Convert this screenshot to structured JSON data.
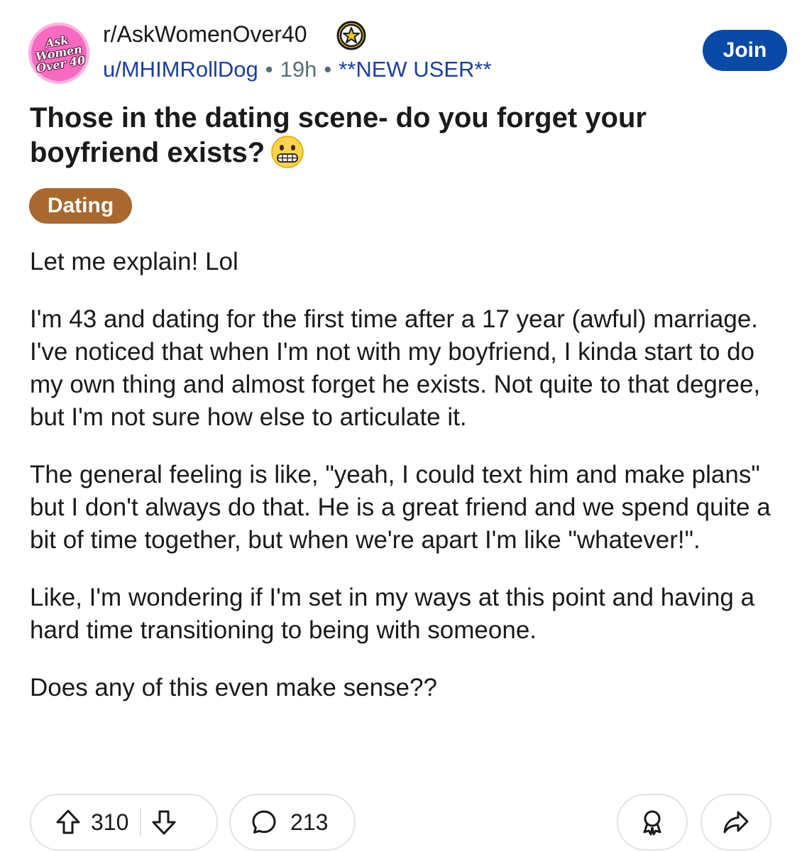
{
  "header": {
    "subreddit": "r/AskWomenOver40",
    "avatar_lines": [
      "Ask",
      "Women",
      "Over 40"
    ],
    "username": "u/MHIMRollDog",
    "separator": "•",
    "time": "19h",
    "user_flair": "**NEW USER**",
    "join_label": "Join",
    "accent_color": "#0a49a6"
  },
  "post": {
    "title": "Those in the dating scene- do you forget your boyfriend exists?",
    "title_emoji": "grimacing-face-emoji",
    "flair": "Dating",
    "flair_color": "#a8682f",
    "paragraphs": [
      "Let me explain! Lol",
      "I'm 43 and dating for the first time after a 17 year (awful) marriage. I've noticed that when I'm not with my boyfriend, I kinda start to do my own thing and almost forget he exists. Not quite to that degree, but I'm not sure how else to articulate it.",
      "The general feeling is like, \"yeah, I could text him and make plans\" but I don't always do that. He is a great friend and we spend quite a bit of time together, but when we're apart I'm like \"whatever!\".",
      "Like, I'm wondering if I'm set in my ways at this point and having a hard time transitioning to being with someone.",
      "Does any of this even make sense??"
    ]
  },
  "actions": {
    "upvotes": "310",
    "comments": "213",
    "icons": [
      "upvote-arrow-icon",
      "downvote-arrow-icon",
      "comment-bubble-icon",
      "award-icon",
      "share-arrow-icon"
    ]
  }
}
